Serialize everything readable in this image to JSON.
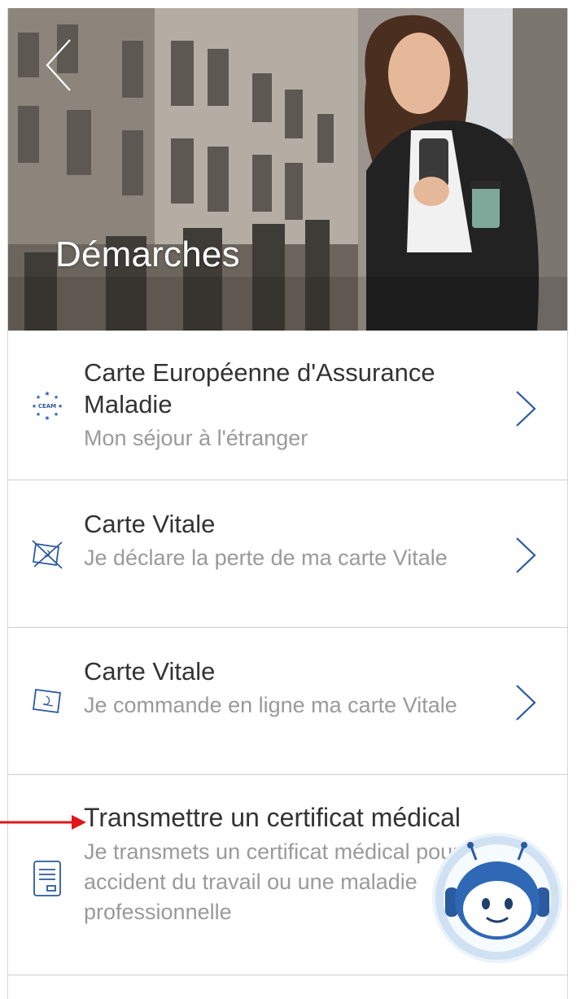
{
  "header": {
    "title": "Démarches",
    "back_icon": "chevron-left-icon"
  },
  "items": [
    {
      "title": "Carte Européenne d'Assurance Maladie",
      "subtitle": "Mon séjour à l'étranger",
      "icon": "ceam-icon",
      "icon_label": "CEAM"
    },
    {
      "title": "Carte Vitale",
      "subtitle": "Je déclare la perte de ma carte Vitale",
      "icon": "card-crossed-icon"
    },
    {
      "title": "Carte Vitale",
      "subtitle": "Je commande en ligne ma carte Vitale",
      "icon": "card-icon"
    },
    {
      "title": "Transmettre un certificat médical",
      "subtitle": "Je transmets un certificat médical pour un accident du travail ou une maladie professionnelle",
      "icon": "document-icon"
    }
  ],
  "colors": {
    "accent": "#2a5a9f",
    "title_text": "#333333",
    "subtitle_text": "#9a9a9a",
    "annotation_arrow": "#e0161b"
  },
  "chatbot": {
    "icon": "chatbot-icon"
  }
}
